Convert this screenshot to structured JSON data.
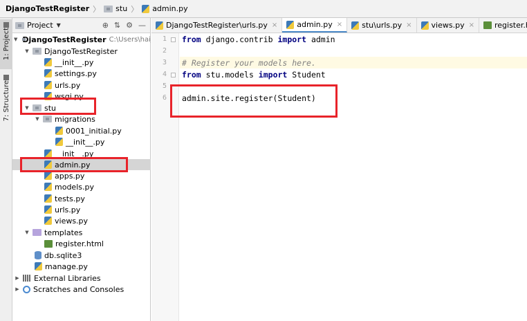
{
  "breadcrumb": {
    "root": "DjangoTestRegister",
    "folder": "stu",
    "file": "admin.py"
  },
  "toolstrip": {
    "project_tab": "1: Project",
    "structure_tab": "7: Structure"
  },
  "project_panel": {
    "title": "Project",
    "tree": [
      {
        "label": "DjangoTestRegister",
        "path": "C:\\Users\\haiji",
        "type": "folder",
        "bold": true
      },
      {
        "label": "DjangoTestRegister",
        "type": "folder"
      },
      {
        "label": "__init__.py",
        "type": "py"
      },
      {
        "label": "settings.py",
        "type": "py"
      },
      {
        "label": "urls.py",
        "type": "py"
      },
      {
        "label": "wsgi.py",
        "type": "py"
      },
      {
        "label": "stu",
        "type": "folder"
      },
      {
        "label": "migrations",
        "type": "folder"
      },
      {
        "label": "0001_initial.py",
        "type": "py"
      },
      {
        "label": "__init__.py",
        "type": "py"
      },
      {
        "label": "__init__.py",
        "type": "py"
      },
      {
        "label": "admin.py",
        "type": "py",
        "selected": true
      },
      {
        "label": "apps.py",
        "type": "py"
      },
      {
        "label": "models.py",
        "type": "py"
      },
      {
        "label": "tests.py",
        "type": "py"
      },
      {
        "label": "urls.py",
        "type": "py"
      },
      {
        "label": "views.py",
        "type": "py"
      },
      {
        "label": "templates",
        "type": "tfolder"
      },
      {
        "label": "register.html",
        "type": "html"
      },
      {
        "label": "db.sqlite3",
        "type": "db"
      },
      {
        "label": "manage.py",
        "type": "py"
      },
      {
        "label": "External Libraries",
        "type": "lib"
      },
      {
        "label": "Scratches and Consoles",
        "type": "scratch"
      }
    ]
  },
  "editor": {
    "tabs": [
      {
        "label": "DjangoTestRegister\\urls.py",
        "active": false
      },
      {
        "label": "admin.py",
        "active": true
      },
      {
        "label": "stu\\urls.py",
        "active": false
      },
      {
        "label": "views.py",
        "active": false
      },
      {
        "label": "register.html",
        "active": false
      }
    ],
    "line_numbers": [
      "1",
      "2",
      "3",
      "4",
      "5",
      "6"
    ],
    "lines": {
      "l1_kw1": "from",
      "l1_mid": " django.contrib ",
      "l1_kw2": "import",
      "l1_end": " admin",
      "l3_comment": "# Register your models here.",
      "l4_kw1": "from",
      "l4_mid": " stu.models ",
      "l4_kw2": "import",
      "l4_end": " Student",
      "l6_code": "admin.site.register(Student)"
    }
  },
  "colors": {
    "highlight_box": "#e8232a",
    "keyword": "#000080",
    "comment": "#808080"
  }
}
